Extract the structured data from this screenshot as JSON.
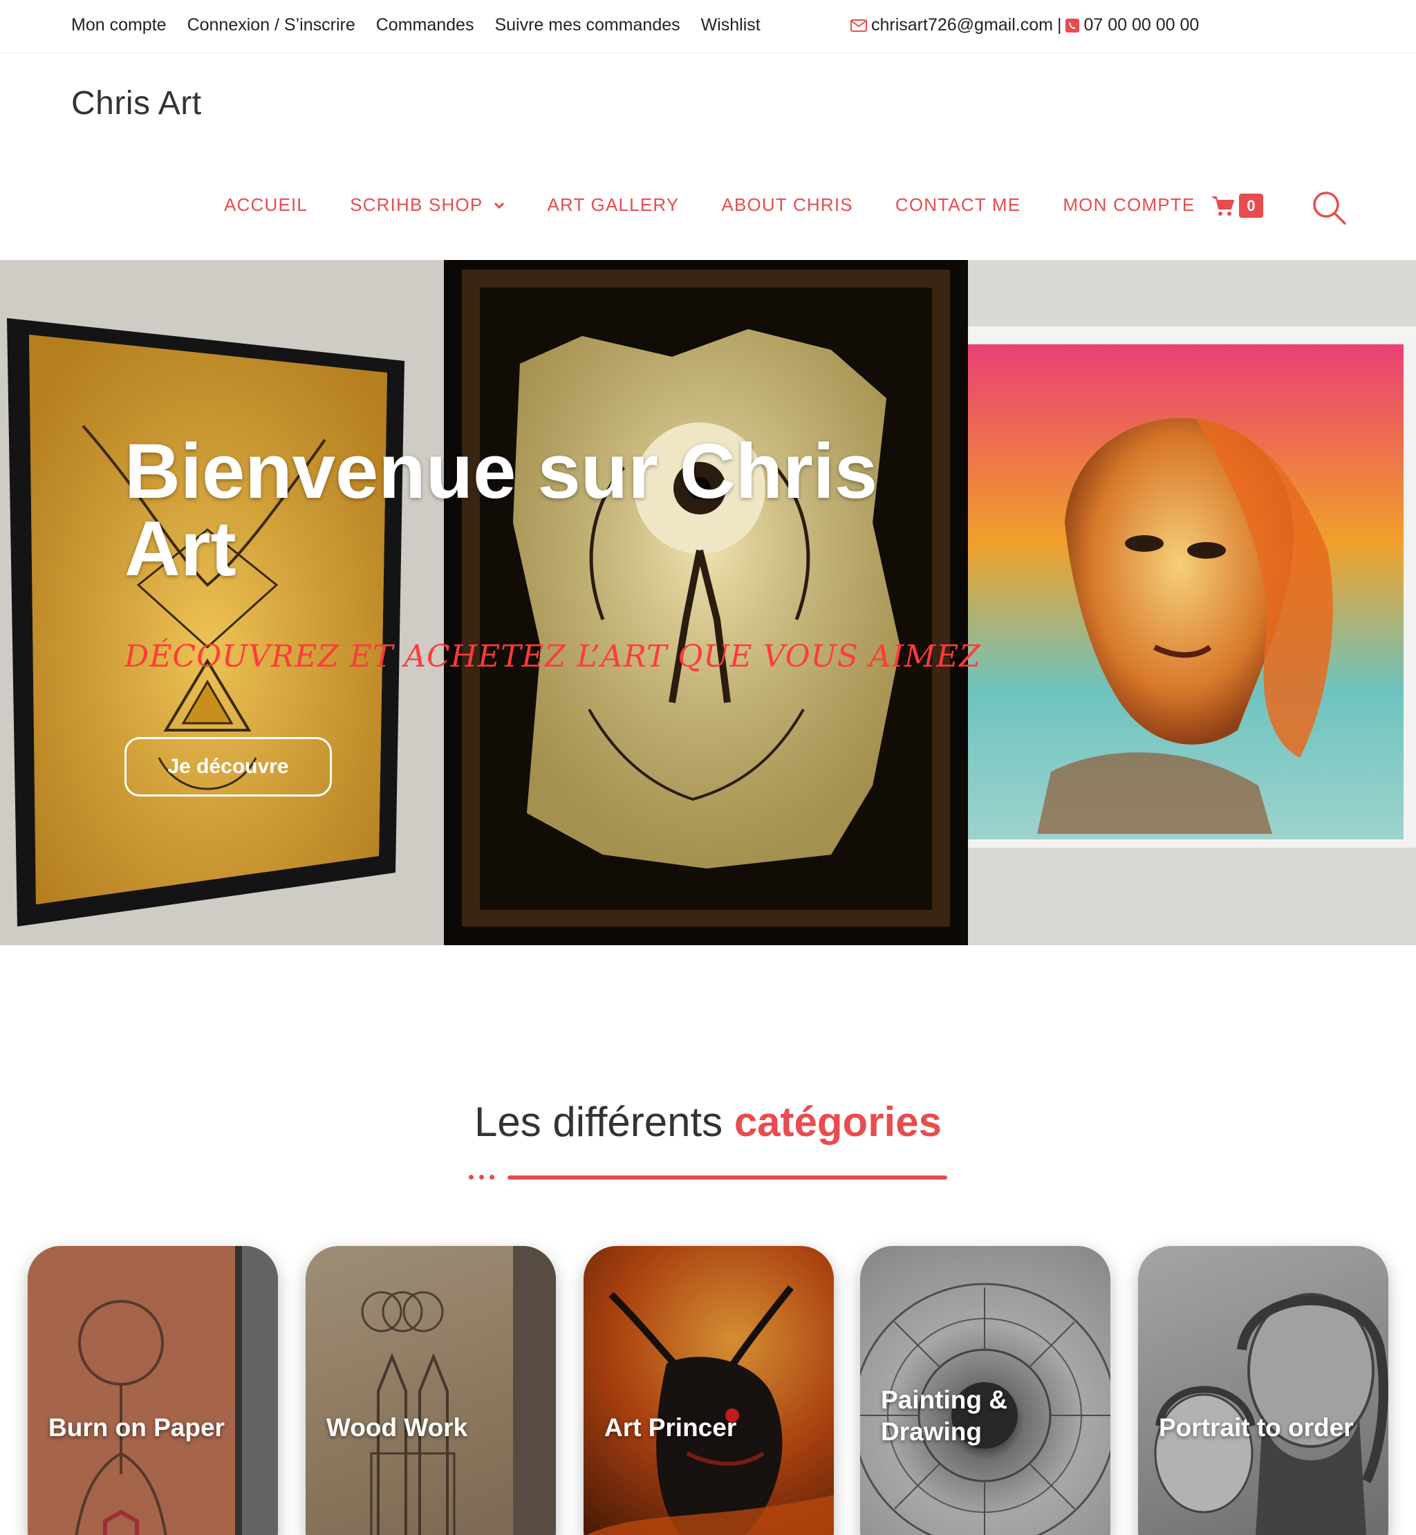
{
  "topbar": {
    "links": [
      "Mon compte",
      "Connexion / S’inscrire",
      "Commandes",
      "Suivre mes commandes",
      "Wishlist"
    ],
    "email": "chrisart726@gmail.com",
    "separator": "|",
    "phone": "07 00 00 00 00"
  },
  "header": {
    "logo": "Chris Art",
    "nav": [
      "ACCUEIL",
      "SCRIHB SHOP",
      "ART GALLERY",
      "ABOUT CHRIS",
      "CONTACT ME",
      "MON COMPTE"
    ],
    "cart_count": "0"
  },
  "hero": {
    "title": "Bienvenue sur Chris Art",
    "subtitle": "DÉCOUVREZ ET ACHETEZ L’ART QUE VOUS AIMEZ",
    "button": "Je découvre"
  },
  "categories": {
    "title_plain": "Les différents",
    "title_accent": "catégories",
    "items": [
      "Burn on Paper",
      "Wood Work",
      "Art Princer",
      "Painting & Drawing",
      "Portrait to order"
    ]
  },
  "colors": {
    "accent": "#e84c4f",
    "text": "#333333",
    "white": "#ffffff"
  },
  "icons": [
    "mail-icon",
    "phone-icon",
    "chevron-down-icon",
    "cart-icon",
    "search-icon"
  ]
}
